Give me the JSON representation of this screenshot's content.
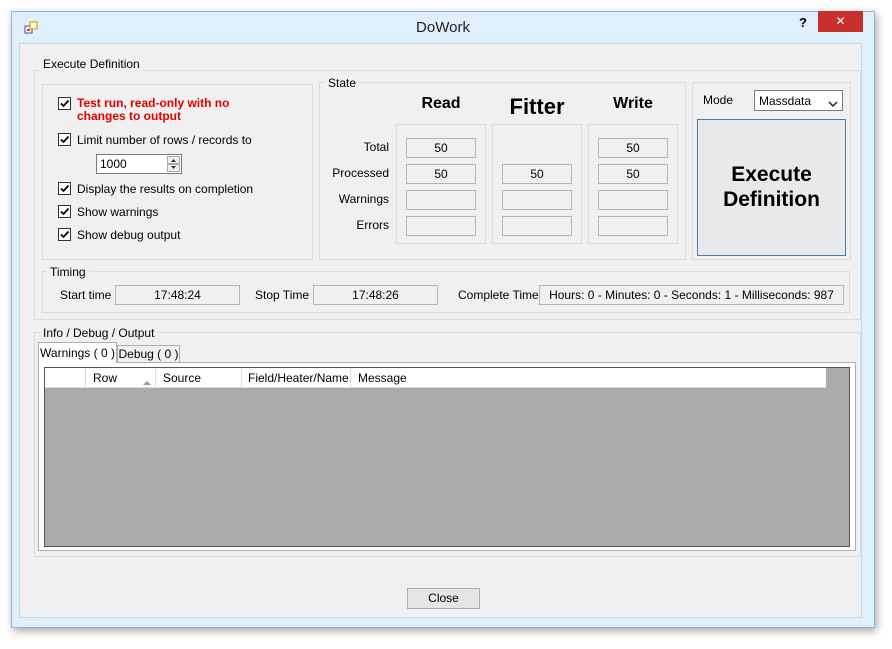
{
  "window": {
    "title": "DoWork",
    "help_label": "?",
    "close_glyph": "✕",
    "app_icon": "app-icon"
  },
  "execute_definition": {
    "group_label": "Execute Definition",
    "test_run": {
      "label_line1": "Test run, read-only with no",
      "label_line2": "changes to output",
      "checked": true,
      "color": "#e00000"
    },
    "limit_rows": {
      "label": "Limit number of rows / records to",
      "checked": true
    },
    "rows_value": "1000",
    "display_results": {
      "label": "Display the results on completion",
      "checked": true
    },
    "show_warnings": {
      "label": "Show warnings",
      "checked": true
    },
    "show_debug": {
      "label": "Show debug output",
      "checked": true
    }
  },
  "state": {
    "group_label": "State",
    "columns": {
      "read": "Read",
      "filter": "Fitter",
      "write": "Write"
    },
    "rows": {
      "total": "Total",
      "processed": "Processed",
      "warnings": "Warnings",
      "errors": "Errors"
    },
    "read": {
      "total": "50",
      "processed": "50",
      "warnings": "",
      "errors": ""
    },
    "filter": {
      "total": "",
      "processed": "50",
      "warnings": "",
      "errors": ""
    },
    "write": {
      "total": "50",
      "processed": "50",
      "warnings": "",
      "errors": ""
    }
  },
  "mode": {
    "label": "Mode",
    "selected": "Massdata",
    "execute_line1": "Execute",
    "execute_line2": "Definition",
    "accent": "#3c7fb1"
  },
  "timing": {
    "group_label": "Timing",
    "start_label": "Start time",
    "start_value": "17:48:24",
    "stop_label": "Stop Time",
    "stop_value": "17:48:26",
    "complete_label": "Complete Time",
    "complete_value": "Hours: 0 - Minutes: 0 - Seconds: 1 - Milliseconds: 987"
  },
  "info": {
    "group_label": "Info / Debug / Output",
    "tabs": {
      "warnings": "Warnings ( 0 )",
      "debug": "Debug ( 0 )"
    },
    "columns": {
      "row": "Row",
      "source": "Source",
      "field": "Field/Heater/Name",
      "message": "Message"
    },
    "grid_bg": "#ababab"
  },
  "footer": {
    "close_label": "Close"
  }
}
